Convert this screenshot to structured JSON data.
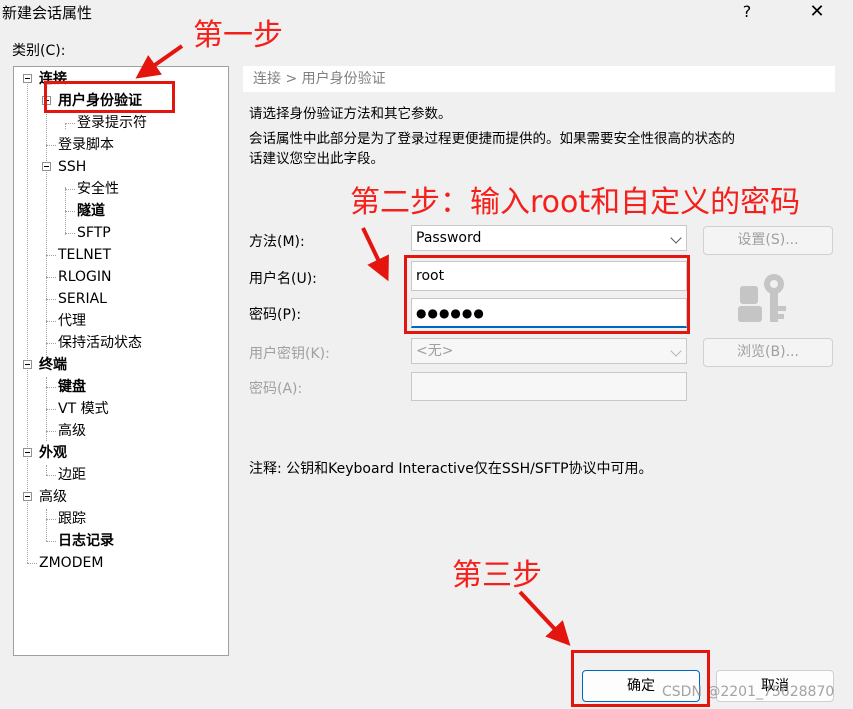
{
  "window": {
    "title": "新建会话属性",
    "help_label": "?",
    "close_label": "✕"
  },
  "category_label": "类别(C):",
  "tree": {
    "connection": "连接",
    "user_auth": "用户身份验证",
    "login_prompt": "登录提示符",
    "login_script": "登录脚本",
    "ssh": "SSH",
    "security": "安全性",
    "tunnel": "隧道",
    "sftp": "SFTP",
    "telnet": "TELNET",
    "rlogin": "RLOGIN",
    "serial": "SERIAL",
    "proxy": "代理",
    "keepalive": "保持活动状态",
    "terminal": "终端",
    "keyboard": "键盘",
    "vt_mode": "VT 模式",
    "advanced_terminal": "高级",
    "appearance": "外观",
    "margin": "边距",
    "advanced": "高级",
    "trace": "跟踪",
    "log": "日志记录",
    "zmodem": "ZMODEM"
  },
  "breadcrumb": "连接 > 用户身份验证",
  "desc": {
    "line1": "请选择身份验证方法和其它参数。",
    "line2": "会话属性中此部分是为了登录过程更便捷而提供的。如果需要安全性很高的状态的",
    "line3": "话建议您空出此字段。"
  },
  "form": {
    "method_label": "方法(M):",
    "method_value": "Password",
    "settings_button": "设置(S)...",
    "username_label": "用户名(U):",
    "username_value": "root",
    "password_label": "密码(P):",
    "password_value": "●●●●●●",
    "user_key_label": "用户密钥(K):",
    "user_key_value": "<无>",
    "browse_button": "浏览(B)...",
    "passphrase_label": "密码(A):"
  },
  "note": "注释: 公钥和Keyboard Interactive仅在SSH/SFTP协议中可用。",
  "buttons": {
    "ok": "确定",
    "cancel": "取消"
  },
  "annotations": {
    "step1": "第一步",
    "step2": "第二步：输入root和自定义的密码",
    "step3": "第三步"
  },
  "watermark": "CSDN @2201_75628870",
  "colors": {
    "annotation": "#e4150f"
  }
}
